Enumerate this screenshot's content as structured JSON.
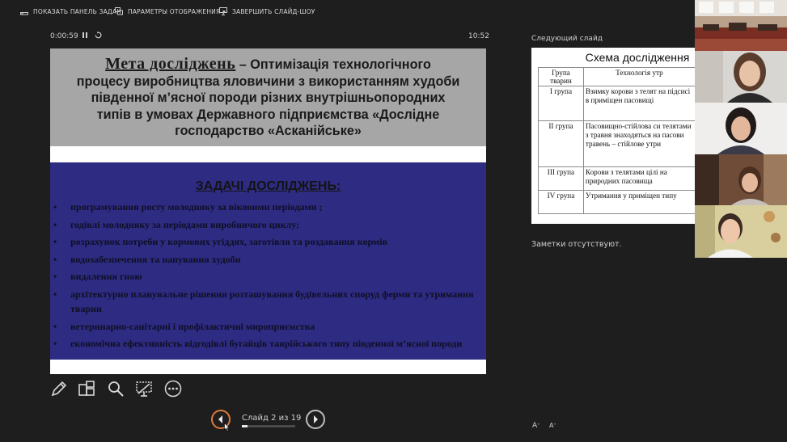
{
  "toolbar": {
    "show_taskbar": "ПОКАЗАТЬ ПАНЕЛЬ ЗАДАЧ",
    "display_settings": "ПАРАМЕТРЫ ОТОБРАЖЕНИЯ ▾",
    "end_show": "ЗАВЕРШИТЬ СЛАЙД-ШОУ"
  },
  "timer": {
    "elapsed": "0:00:59",
    "clock": "10:52"
  },
  "slide": {
    "goal_heading": "Мета досліджень",
    "goal_text_lines": [
      " – Оптимізація технологічного",
      "процесу виробництва яловичини з використанням худоби",
      "південної м’ясної породи різних внутрішньопородних",
      "типів в умовах Державного підприємства «Дослідне",
      "господарство «Асканійське»"
    ],
    "tasks_heading": "ЗАДАЧІ ДОСЛІДЖЕНЬ:",
    "tasks": [
      "програмування  росту молодняку за віковими періодами ;",
      " годівлі молодняку за періодами виробничого циклу;",
      "розрахунок потреби у кормових угіддях, заготівля та роздавання кормів",
      "водозабезпечення та напування худоби",
      "видалення гною",
      "архітектурно планувальне рішення розташування будівельних споруд ферми та утримання тварин",
      "ветеринарно-санітарні і профілактичні мироприємства",
      "економічна ефективність відгодівлі бугайців таврійського типу південної м’ясної породи"
    ]
  },
  "navigation": {
    "slide_counter": "Слайд 2 из 19",
    "progress_fraction": 0.105
  },
  "next_slide": {
    "label": "Следующий слайд",
    "title": "Схема дослідження",
    "headers": [
      "Група тварин",
      "Технологія утр"
    ],
    "rows": [
      {
        "group": "І група",
        "tech": "Взимку корови з телят на підсисі в приміщен пасовищі"
      },
      {
        "group": "ІІ група",
        "tech": "Пасовищно-стійлова си телятами з травня знаходяться на пасови травень – стійлове утри"
      },
      {
        "group": "ІІІ група",
        "tech": "Корови з телятами цілі на природних пасовища"
      },
      {
        "group": "IV група",
        "tech": "Утримання у приміщен типу"
      }
    ]
  },
  "notes": {
    "text": "Заметки отсутствуют."
  },
  "font_controls": {
    "increase": "A",
    "decrease": "A"
  },
  "colors": {
    "slide_header_bg": "#a6a6a6",
    "slide_band_bg": "#2d2b82",
    "nav_accent": "#e07a3c"
  }
}
